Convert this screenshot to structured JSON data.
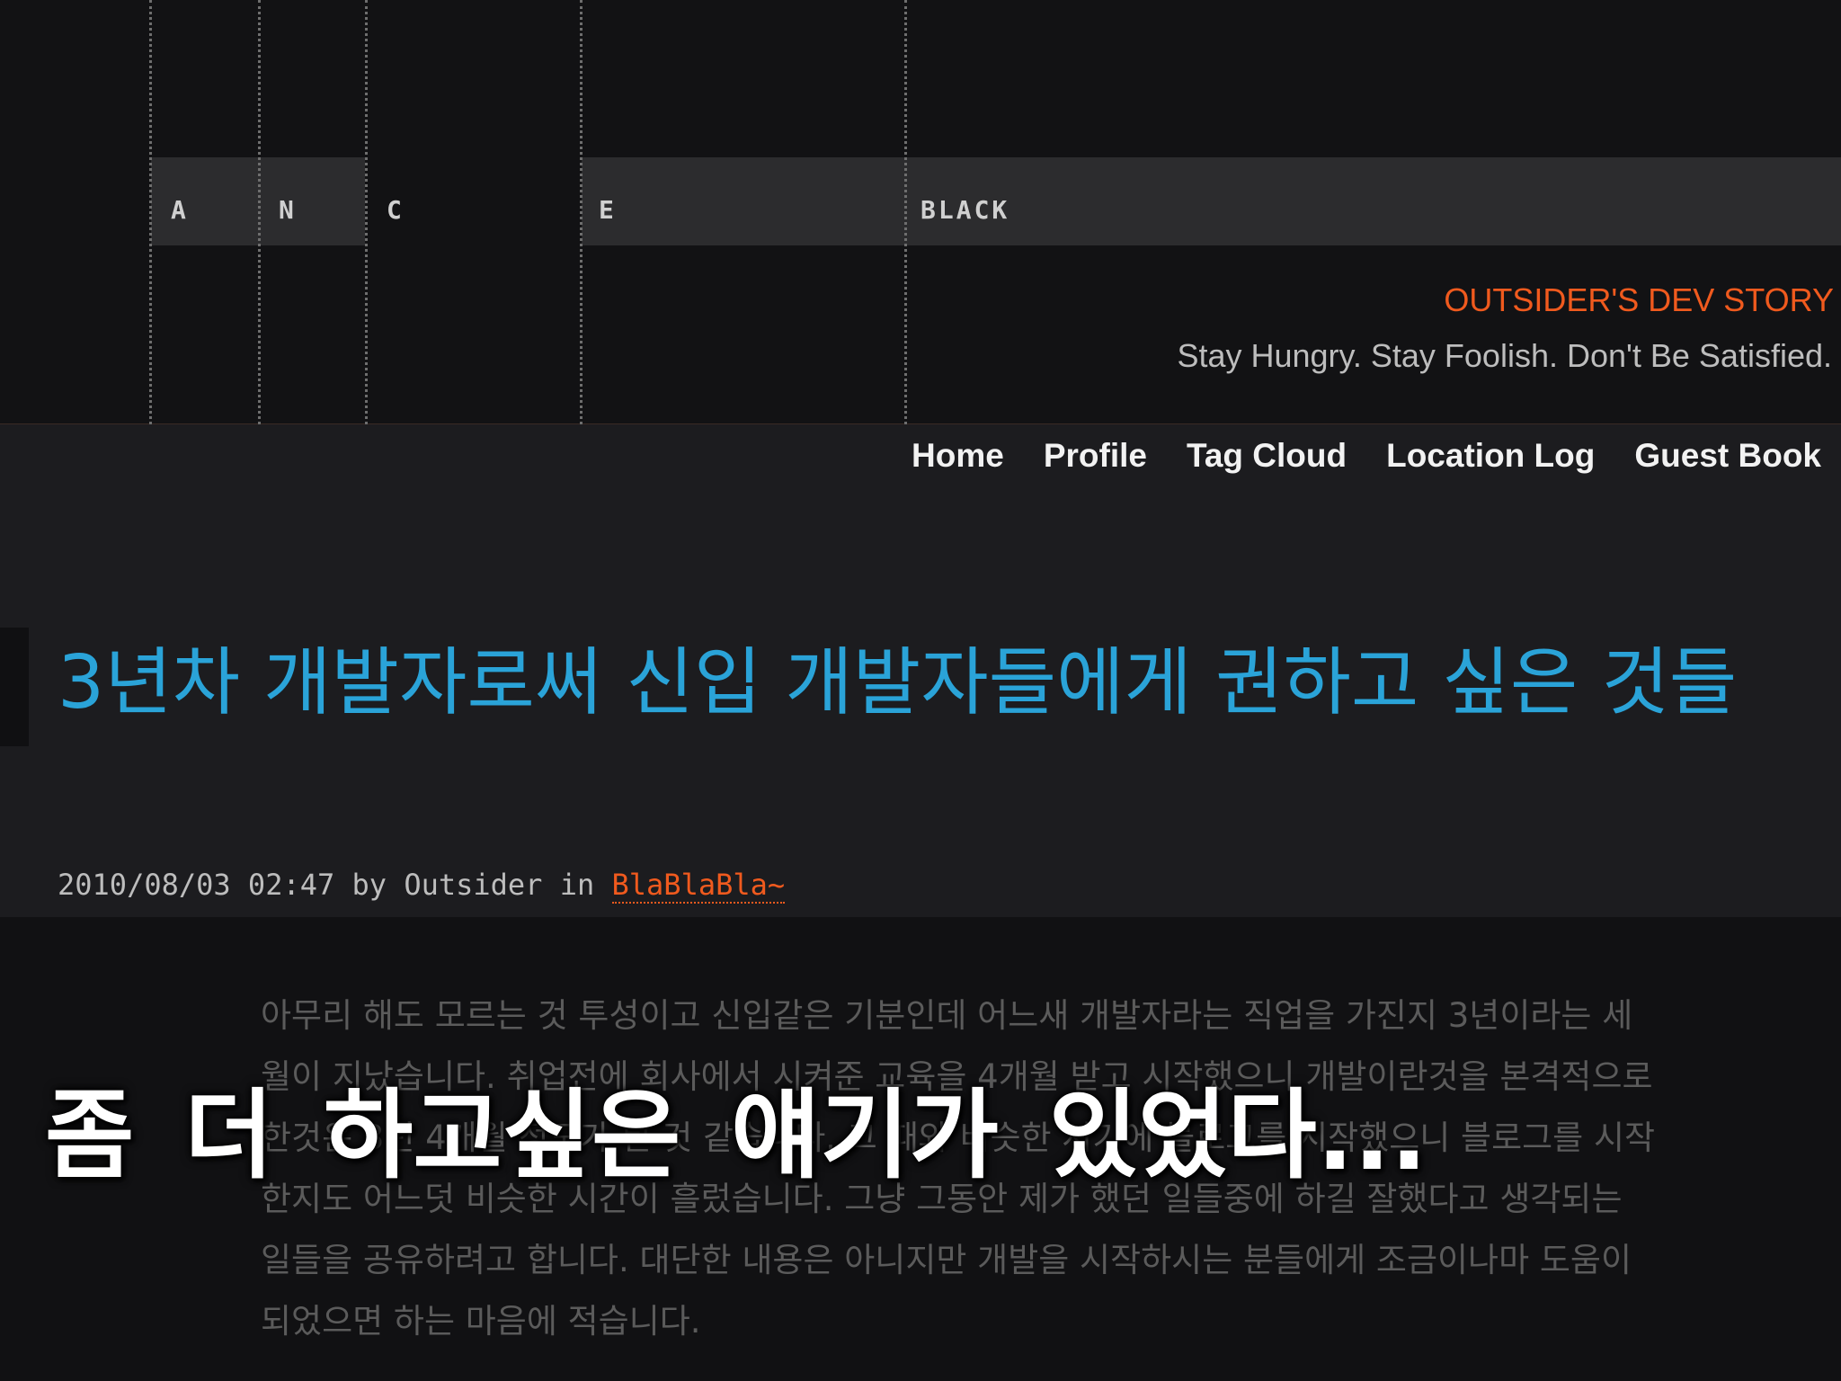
{
  "header": {
    "letters": [
      "A",
      "N",
      "C",
      "E",
      "BLACK"
    ],
    "blog_title": "OUTSIDER'S DEV STORY",
    "tagline": "Stay Hungry. Stay Foolish. Don't Be Satisfied."
  },
  "nav": {
    "items": [
      {
        "label": "Home"
      },
      {
        "label": "Profile"
      },
      {
        "label": "Tag Cloud"
      },
      {
        "label": "Location Log"
      },
      {
        "label": "Guest Book"
      }
    ]
  },
  "post": {
    "title": "3년차 개발자로써 신입 개발자들에게 권하고 싶은 것들",
    "meta_prefix": "2010/08/03 02:47 by Outsider in ",
    "category": "BlaBlaBla~",
    "body_lines": [
      "아무리 해도 모르는 것 투성이고 신입같은 기분인데 어느새 개발자라는 직업을 가진지 3년이라는 세",
      "월이 지났습니다. 취업전에 회사에서 시켜준 교육을 4개월 받고 시작했으니 개발이란것을 본격적으로",
      "한것은 3년 4개월 정도가 된 것 같습니다. 그 때와 비슷한 시기에 블로그를 시작했으니 블로그를 시작",
      "한지도 어느덧 비슷한 시간이 흘렀습니다. 그냥 그동안 제가 했던 일들중에 하길 잘했다고 생각되는",
      "일들을 공유하려고 합니다. 대단한 내용은 아니지만 개발을 시작하시는 분들에게 조금이나마 도움이",
      "되었으면 하는 마음에 적습니다."
    ]
  },
  "caption": {
    "text": "좀 더 하고싶은 얘기가 있었다..."
  },
  "colors": {
    "accent_orange": "#f05a1e",
    "title_blue": "#2aa3d8"
  }
}
